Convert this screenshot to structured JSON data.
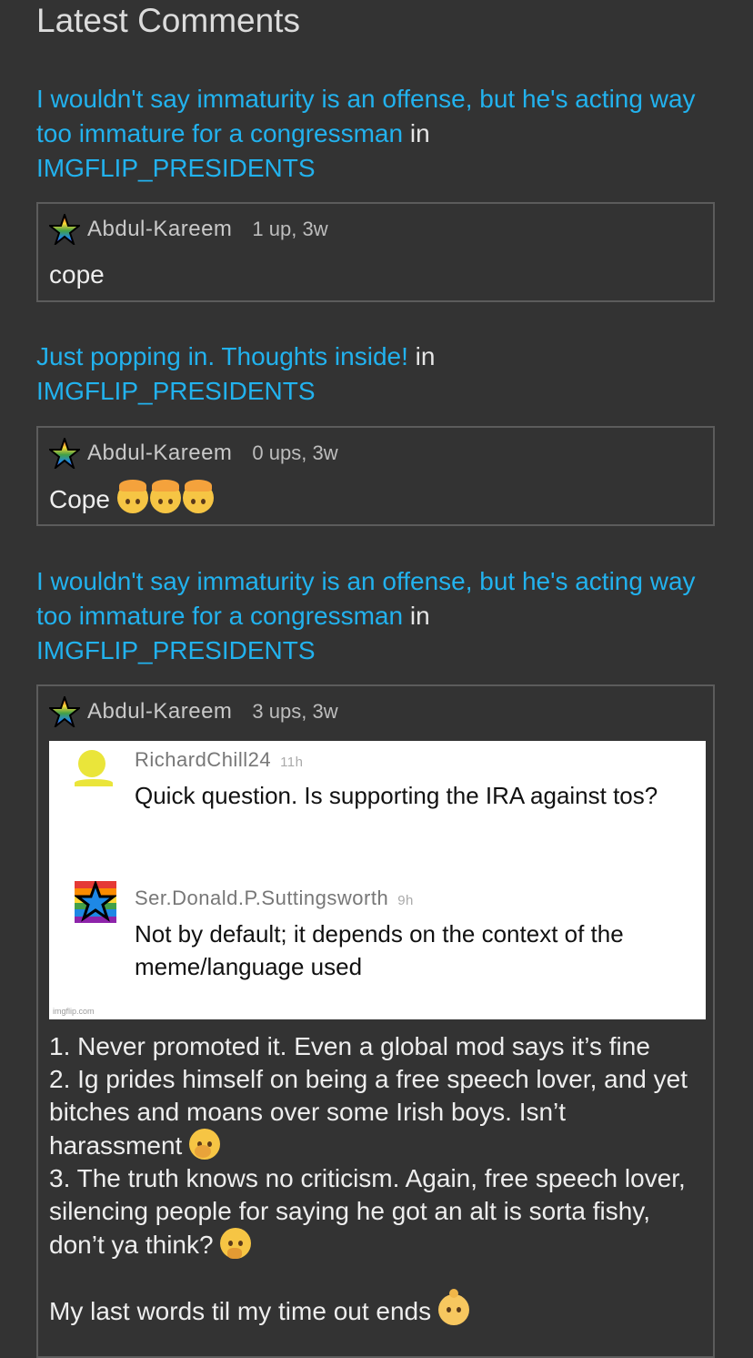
{
  "page": {
    "heading": "Latest Comments"
  },
  "colors": {
    "background": "#333333",
    "link": "#22b2ee",
    "border": "#5c5c5c"
  },
  "entries": [
    {
      "post_title": "I wouldn't say immaturity is an offense, but he's acting way too immature for a congressman",
      "in_word": " in ",
      "stream": "IMGFLIP_PRESIDENTS",
      "comment": {
        "user": "Abdul-Kareem",
        "meta": "1 up, 3w",
        "text": "cope"
      }
    },
    {
      "post_title": "Just popping in. Thoughts inside!",
      "in_word": " in ",
      "stream": "IMGFLIP_PRESIDENTS",
      "comment": {
        "user": "Abdul-Kareem",
        "meta": "0 ups, 3w",
        "text": "Cope",
        "emojis": [
          "mind-blown-icon",
          "mind-blown-icon",
          "mind-blown-icon"
        ]
      }
    },
    {
      "post_title": "I wouldn't say immaturity is an offense, but he's acting way too immature for a congressman",
      "in_word": " in ",
      "stream": "IMGFLIP_PRESIDENTS",
      "comment": {
        "user": "Abdul-Kareem",
        "meta": "3 ups, 3w",
        "screenshot": {
          "reply1": {
            "user": "RichardChill24",
            "time": "11h",
            "text": "Quick question. Is supporting the IRA against tos?"
          },
          "reply2": {
            "user": "Ser.Donald.P.Suttingsworth",
            "time": "9h",
            "text": "Not by default; it depends on the context of the meme/language used"
          },
          "watermark": "imgflip.com"
        },
        "lines": [
          "1. Never promoted it. Even a global mod says it’s fine",
          "2. Ig prides himself on being a free speech lover, and yet bitches and moans over some Irish boys. Isn’t harassment",
          "3. The truth knows no criticism. Again, free speech lover, silencing people for saying he got an alt is sorta fishy, don’t ya think?",
          "My last words til my time out ends"
        ],
        "emojis": [
          "shushing-face-icon",
          "thinking-face-icon",
          "baby-icon"
        ]
      }
    }
  ]
}
